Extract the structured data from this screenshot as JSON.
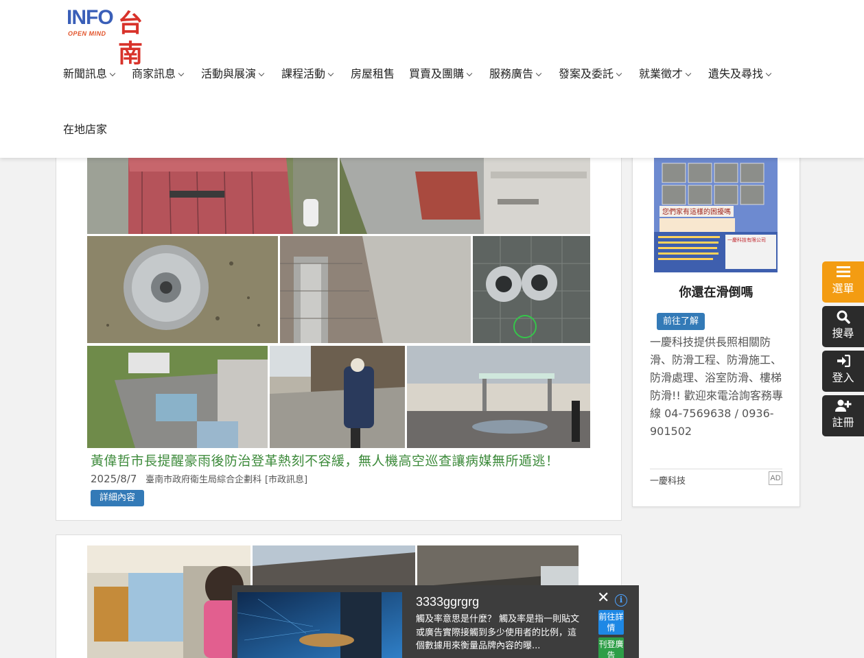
{
  "logo": {
    "en": "INFO",
    "sub": "OPEN MIND",
    "city": "台南"
  },
  "nav": [
    {
      "label": "新聞訊息",
      "caret": true
    },
    {
      "label": "商家訊息",
      "caret": true
    },
    {
      "label": "活動與展演",
      "caret": true
    },
    {
      "label": "課程活動",
      "caret": true
    },
    {
      "label": "房屋租售",
      "caret": false
    },
    {
      "label": "買賣及團購",
      "caret": true
    },
    {
      "label": "服務廣告",
      "caret": true
    },
    {
      "label": "發案及委託",
      "caret": true
    },
    {
      "label": "就業徵才",
      "caret": true
    },
    {
      "label": "遺失及尋找",
      "caret": true
    },
    {
      "label": "在地店家",
      "caret": false
    }
  ],
  "article": {
    "title": "黃偉哲市長提醒豪雨後防治登革熱刻不容緩，無人機高空巡查讓病媒無所遁逃！",
    "date": "2025/8/7",
    "source": "臺南市政府衛生局綜合企劃科",
    "category": "[市政訊息]",
    "detail_label": "詳細內容"
  },
  "sidebar_ad": {
    "title": "你還在滑倒嗎",
    "button_label": "前往了解",
    "description": "一慶科技提供長照相關防滑、防滑工程、防滑施工、防滑處理、浴室防滑、樓梯防滑!! 歡迎來電洽詢客務專線 04-7569638 / 0936-901502",
    "sponsor": "一慶科技",
    "badge": "AD",
    "image_caption": "您們家有這樣的困擾嗎",
    "image_company": "一慶科技有限公司"
  },
  "float_buttons": {
    "menu": "選單",
    "search": "搜尋",
    "login": "登入",
    "register": "註冊"
  },
  "popup_ad": {
    "title": "3333ggrgrg",
    "text": "觸及率意思是什麼？ 觸及率是指一則貼文或廣告實際接觸到多少使用者的比例，這個數據用來衡量品牌內容的曝...",
    "close": "✕",
    "info": "i",
    "go_label": "前往詳情",
    "post_label": "刊登廣告"
  },
  "colors": {
    "title_green": "#3c8a3a",
    "button_blue": "#337ab7",
    "menu_orange": "#f39c12",
    "dark_button": "#2b2b2b"
  }
}
